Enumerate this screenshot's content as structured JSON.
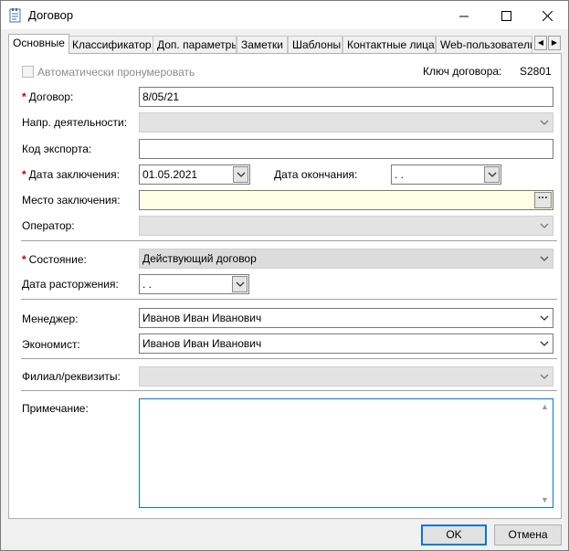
{
  "window": {
    "title": "Договор"
  },
  "tabs": [
    "Основные",
    "Классификатор",
    "Доп. параметры",
    "Заметки",
    "Шаблоны",
    "Контактные лица",
    "Web-пользователи"
  ],
  "auto_number": {
    "label": "Автоматически пронумеровать",
    "checked": false
  },
  "contract_key": {
    "label": "Ключ договора:",
    "value": "S2801"
  },
  "fields": {
    "contract": {
      "label": "Договор:",
      "value": "8/05/21"
    },
    "activity": {
      "label": "Напр. деятельности:",
      "value": ""
    },
    "export_code": {
      "label": "Код экспорта:",
      "value": ""
    },
    "conclusion_date": {
      "label": "Дата заключения:",
      "value": "01.05.2021"
    },
    "end_date": {
      "label": "Дата окончания:",
      "value": " .  ."
    },
    "place": {
      "label": "Место заключения:",
      "value": ""
    },
    "operator": {
      "label": "Оператор:",
      "value": ""
    },
    "state": {
      "label": "Состояние:",
      "value": "Действующий договор"
    },
    "termination_date": {
      "label": "Дата расторжения:",
      "value": " .  ."
    },
    "manager": {
      "label": "Менеджер:",
      "value": "Иванов Иван Иванович"
    },
    "economist": {
      "label": "Экономист:",
      "value": "Иванов Иван Иванович"
    },
    "branch": {
      "label": "Филиал/реквизиты:",
      "value": ""
    },
    "note": {
      "label": "Примечание:",
      "value": ""
    }
  },
  "buttons": {
    "ok": "OK",
    "cancel": "Отмена"
  },
  "icons": {
    "app": "document-icon",
    "minimize": "minimize-icon",
    "maximize": "maximize-icon",
    "close": "close-icon",
    "dropdown": "chevron-down-icon",
    "ellipsis": "ellipsis-icon",
    "tab_left": "arrow-left-icon",
    "tab_right": "arrow-right-icon"
  }
}
